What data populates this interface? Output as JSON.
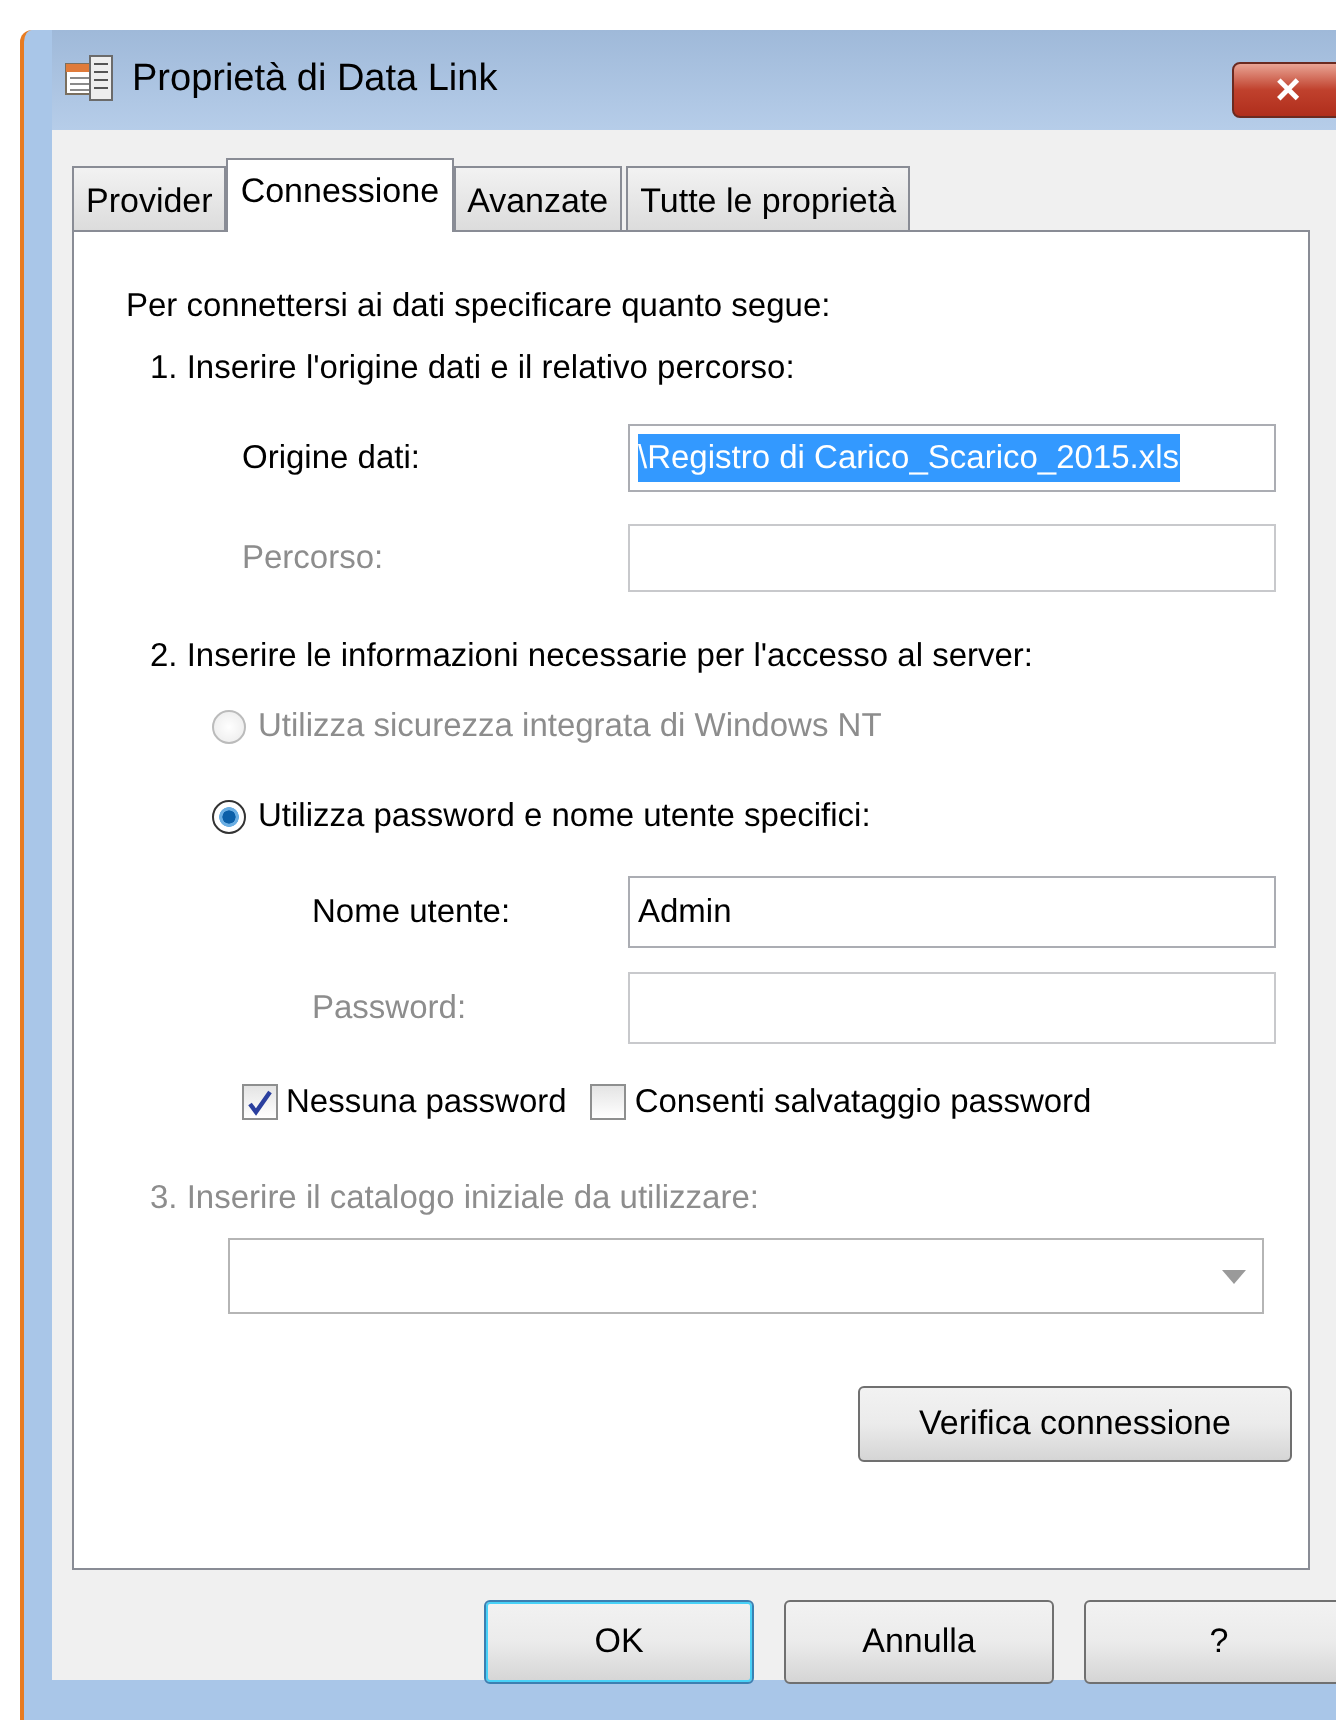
{
  "window": {
    "title": "Proprietà di Data Link",
    "close_label": "×"
  },
  "tabs": [
    {
      "label": "Provider",
      "selected": false
    },
    {
      "label": "Connessione",
      "selected": true
    },
    {
      "label": "Avanzate",
      "selected": false
    },
    {
      "label": "Tutte le proprietà",
      "selected": false
    }
  ],
  "intro": "Per connettersi ai dati specificare quanto segue:",
  "section_1": {
    "label": "1. Inserire l'origine dati e il relativo percorso:",
    "data_source": {
      "label": "Origine dati:",
      "value": "\\Registro di Carico_Scarico_2015.xls",
      "text_selected": true,
      "disabled": false
    },
    "path": {
      "label": "Percorso:",
      "disabled": true
    }
  },
  "section_2": {
    "label": "2. Inserire le informazioni necessarie per l'accesso al server:",
    "radios": [
      {
        "label": "Utilizza sicurezza integrata di Windows NT",
        "selected": false,
        "disabled": true
      },
      {
        "label": "Utilizza password e nome utente specifici:",
        "selected": true,
        "disabled": false
      }
    ],
    "username": {
      "label": "Nome utente:",
      "value": "Admin",
      "disabled": false
    },
    "password": {
      "label": "Password:",
      "disabled": true
    },
    "checkboxes": [
      {
        "label": "Nessuna password",
        "checked": true
      },
      {
        "label": "Consenti salvataggio password",
        "checked": false
      }
    ]
  },
  "section_3": {
    "label": "3. Inserire il catalogo iniziale da utilizzare:",
    "disabled": true
  },
  "test_button": "Verifica connessione",
  "buttons": [
    {
      "label": "OK",
      "default": true
    },
    {
      "label": "Annulla",
      "default": false
    },
    {
      "label": "?",
      "default": false
    }
  ]
}
